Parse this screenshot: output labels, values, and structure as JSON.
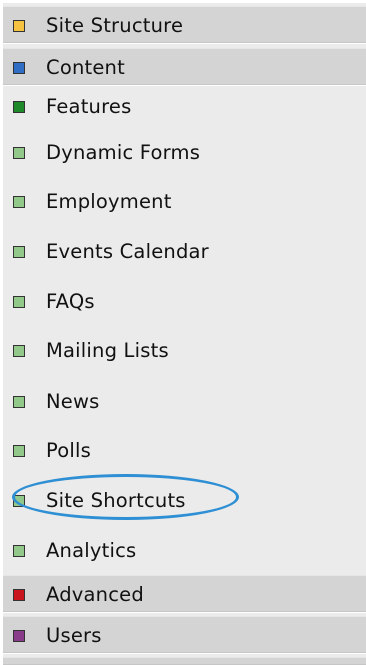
{
  "colors": {
    "site_structure": "#f5c242",
    "content": "#2f6ec4",
    "features": "#1e8a2a",
    "feature_item": "#92c98a",
    "advanced": "#c8141c",
    "users": "#8a3c8a",
    "highlight_oval": "#2e8fd4"
  },
  "menu": {
    "site_structure": "Site Structure",
    "content": "Content",
    "features": "Features",
    "dynamic_forms": "Dynamic Forms",
    "employment": "Employment",
    "events_calendar": "Events Calendar",
    "faqs": "FAQs",
    "mailing_lists": "Mailing Lists",
    "news": "News",
    "polls": "Polls",
    "site_shortcuts": "Site Shortcuts",
    "analytics": "Analytics",
    "advanced": "Advanced",
    "users": "Users"
  }
}
